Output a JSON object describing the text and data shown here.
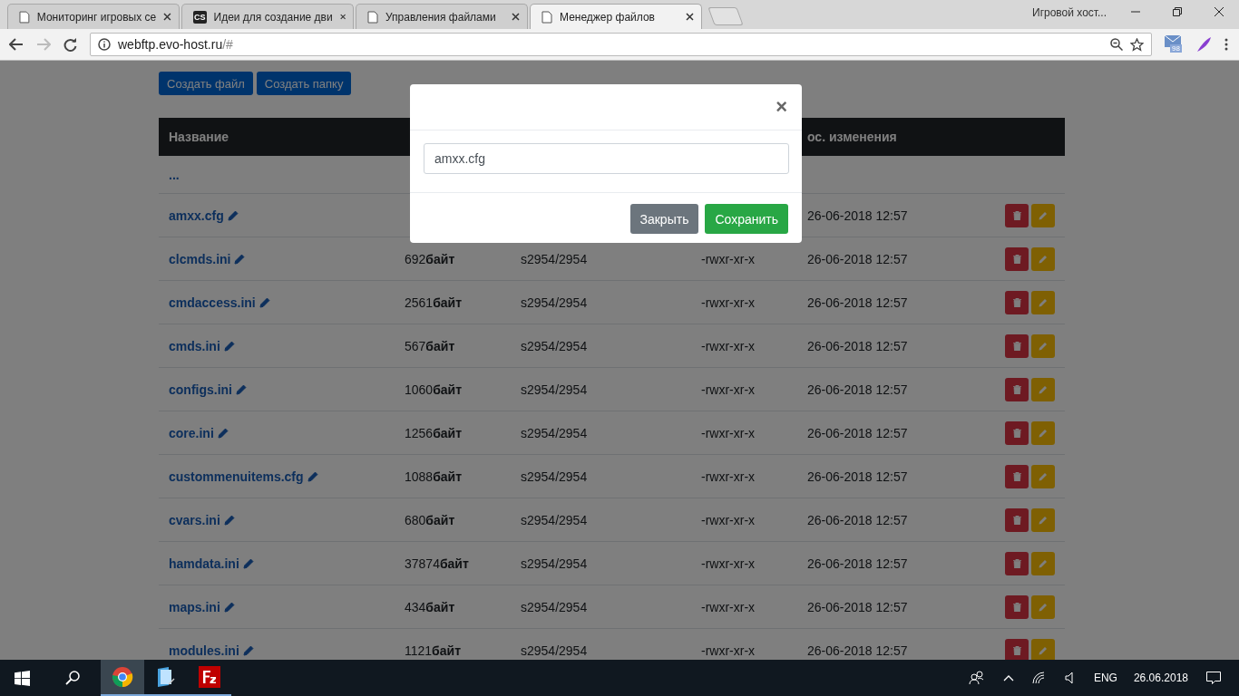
{
  "browser": {
    "tabs": [
      {
        "title": "Мониторинг игровых се",
        "kind": "page",
        "selected": false
      },
      {
        "title": "Идеи для создание дви",
        "kind": "logo",
        "icon_text": "CS",
        "selected": false
      },
      {
        "title": "Управления файлами",
        "kind": "page",
        "selected": false
      },
      {
        "title": "Менеджер файлов",
        "kind": "page",
        "selected": true
      }
    ],
    "window_title": "Игровой хост...",
    "address": {
      "host": "webftp.evo-host.ru",
      "path": "/#"
    },
    "extension_badge": "98"
  },
  "toolbar": {
    "buttons": [
      "Создать файл",
      "Создать папку"
    ]
  },
  "table": {
    "columns": [
      "Название",
      "ос. изменения"
    ],
    "parent_link": "...",
    "rows": [
      {
        "name": "amxx.cfg",
        "modified": "26-06-2018 12:57"
      },
      {
        "name": "clcmds.ini",
        "size": "692",
        "unit": "байт",
        "owner": "s2954/2954",
        "perms": "-rwxr-xr-x",
        "modified": "26-06-2018 12:57"
      },
      {
        "name": "cmdaccess.ini",
        "size": "2561",
        "unit": "байт",
        "owner": "s2954/2954",
        "perms": "-rwxr-xr-x",
        "modified": "26-06-2018 12:57"
      },
      {
        "name": "cmds.ini",
        "size": "567",
        "unit": "байт",
        "owner": "s2954/2954",
        "perms": "-rwxr-xr-x",
        "modified": "26-06-2018 12:57"
      },
      {
        "name": "configs.ini",
        "size": "1060",
        "unit": "байт",
        "owner": "s2954/2954",
        "perms": "-rwxr-xr-x",
        "modified": "26-06-2018 12:57"
      },
      {
        "name": "core.ini",
        "size": "1256",
        "unit": "байт",
        "owner": "s2954/2954",
        "perms": "-rwxr-xr-x",
        "modified": "26-06-2018 12:57"
      },
      {
        "name": "custommenuitems.cfg",
        "size": "1088",
        "unit": "байт",
        "owner": "s2954/2954",
        "perms": "-rwxr-xr-x",
        "modified": "26-06-2018 12:57"
      },
      {
        "name": "cvars.ini",
        "size": "680",
        "unit": "байт",
        "owner": "s2954/2954",
        "perms": "-rwxr-xr-x",
        "modified": "26-06-2018 12:57"
      },
      {
        "name": "hamdata.ini",
        "size": "37874",
        "unit": "байт",
        "owner": "s2954/2954",
        "perms": "-rwxr-xr-x",
        "modified": "26-06-2018 12:57"
      },
      {
        "name": "maps.ini",
        "size": "434",
        "unit": "байт",
        "owner": "s2954/2954",
        "perms": "-rwxr-xr-x",
        "modified": "26-06-2018 12:57"
      },
      {
        "name": "modules.ini",
        "size": "1121",
        "unit": "байт",
        "owner": "s2954/2954",
        "perms": "-rwxr-xr-x",
        "modified": "26-06-2018 12:57"
      }
    ]
  },
  "modal": {
    "close": "×",
    "input_value": "amxx.cfg",
    "buttons": [
      {
        "label": "Закрыть",
        "kind": "secondary"
      },
      {
        "label": "Сохранить",
        "kind": "primary"
      }
    ]
  },
  "taskbar": {
    "apps": [
      {
        "kind": "chrome",
        "selected": true
      },
      {
        "kind": "files",
        "selected": false
      },
      {
        "kind": "filezilla",
        "selected": false
      }
    ],
    "language": "ENG",
    "date": "26.06.2018"
  }
}
